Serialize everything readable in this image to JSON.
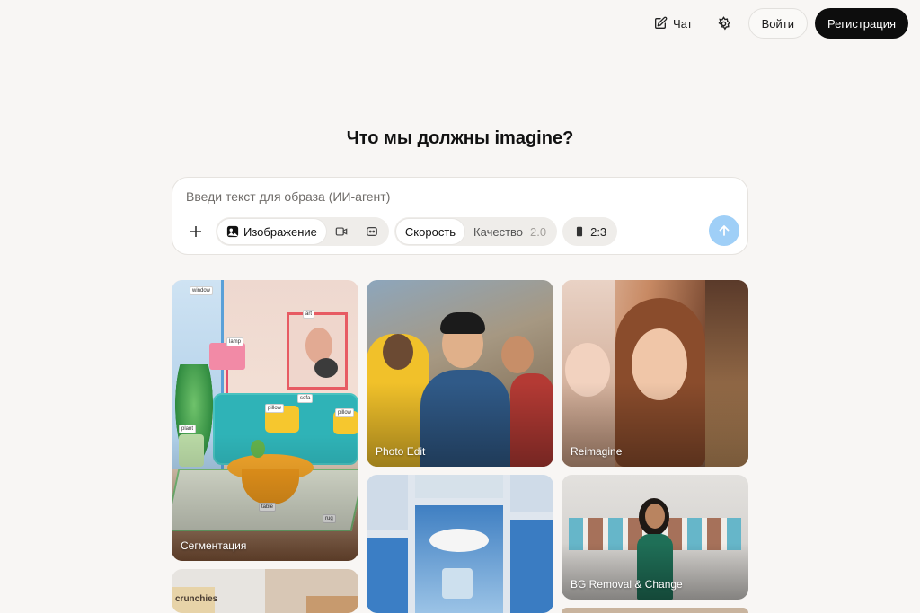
{
  "header": {
    "chat_label": "Чат",
    "login_label": "Войти",
    "signup_label": "Регистрация"
  },
  "headline": "Что мы должны imagine?",
  "prompt": {
    "placeholder": "Введи текст для образа (ИИ-агент)",
    "mode_image_label": "Изображение",
    "speed_label": "Скорость",
    "quality_label": "Качество",
    "quality_version": "2.0",
    "ratio_label": "2:3"
  },
  "gallery": {
    "segmentation_label": "Сегментация",
    "photo_edit_label": "Photo Edit",
    "reimagine_label": "Reimagine",
    "bg_removal_label": "BG Removal & Change",
    "segmentation_tags": [
      "window",
      "art",
      "lamp",
      "sofa",
      "pillow",
      "pillow",
      "plant",
      "table",
      "rug"
    ],
    "crunchies_text": "crunchies"
  },
  "colors": {
    "accent_send": "#9fcff7",
    "signup_bg": "#0d0d0d",
    "page_bg": "#f8f6f4"
  },
  "icons": [
    "edit-icon",
    "gear-icon",
    "plus-icon",
    "image-icon",
    "video-icon",
    "bot-icon",
    "phone-ratio-icon",
    "arrow-up-icon"
  ]
}
